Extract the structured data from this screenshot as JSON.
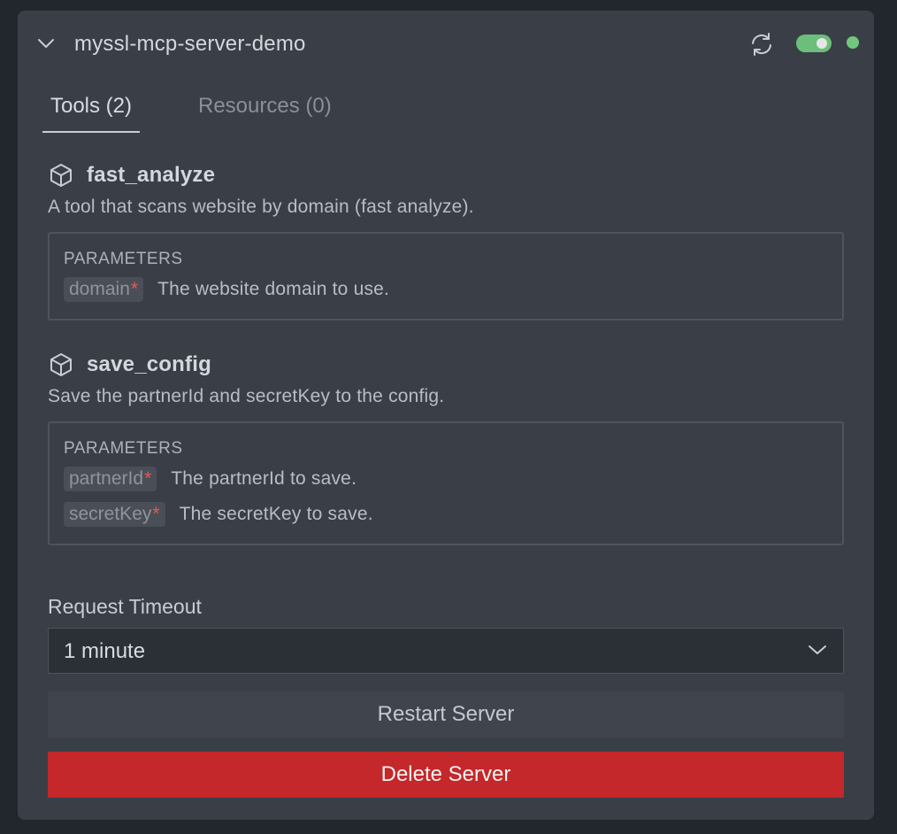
{
  "server": {
    "name": "myssl-mcp-server-demo",
    "enabled": true,
    "status_color": "#73c77d",
    "toggle_color": "#6bbf7a"
  },
  "icons": {
    "collapse": "chevron-down-icon",
    "refresh": "refresh-icon",
    "tool": "cube-icon",
    "select": "chevron-down-icon"
  },
  "tabs": [
    {
      "label": "Tools (2)",
      "active": true
    },
    {
      "label": "Resources (0)",
      "active": false
    }
  ],
  "tools": [
    {
      "name": "fast_analyze",
      "description": "A tool that scans website by domain (fast analyze).",
      "params_title": "PARAMETERS",
      "params": [
        {
          "name": "domain",
          "required": "*",
          "description": "The website domain to use."
        }
      ]
    },
    {
      "name": "save_config",
      "description": "Save the partnerId and secretKey to the config.",
      "params_title": "PARAMETERS",
      "params": [
        {
          "name": "partnerId",
          "required": "*",
          "description": "The partnerId to save."
        },
        {
          "name": "secretKey",
          "required": "*",
          "description": "The secretKey to save."
        }
      ]
    }
  ],
  "timeout": {
    "label": "Request Timeout",
    "value": "1 minute"
  },
  "buttons": {
    "restart": "Restart Server",
    "delete": "Delete Server",
    "delete_color": "#c4282a"
  }
}
